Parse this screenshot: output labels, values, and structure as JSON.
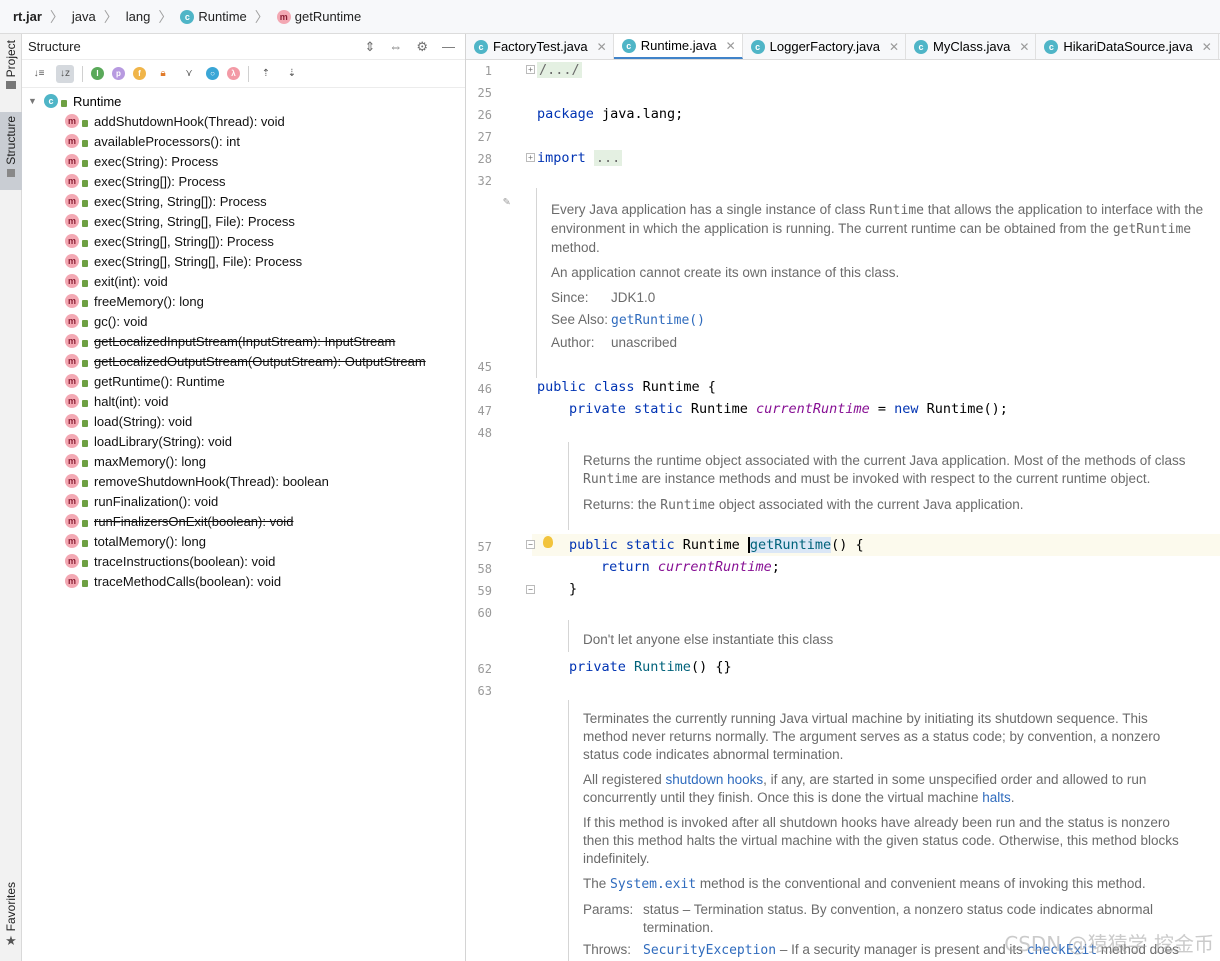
{
  "breadcrumb": [
    {
      "label": "rt.jar",
      "icon": "none"
    },
    {
      "label": "java",
      "icon": "none"
    },
    {
      "label": "lang",
      "icon": "none"
    },
    {
      "label": "Runtime",
      "icon": "class-icon"
    },
    {
      "label": "getRuntime",
      "icon": "method-icon"
    }
  ],
  "stripe": {
    "project": "Project",
    "structure": "Structure",
    "favorites": "Favorites"
  },
  "structure": {
    "title": "Structure",
    "toolbar": {
      "p": "p",
      "f": "f",
      "lambda": "λ",
      "i": "I"
    },
    "root": "Runtime",
    "items": [
      {
        "label": "addShutdownHook(Thread): void",
        "deprecated": false
      },
      {
        "label": "availableProcessors(): int",
        "deprecated": false
      },
      {
        "label": "exec(String): Process",
        "deprecated": false
      },
      {
        "label": "exec(String[]): Process",
        "deprecated": false
      },
      {
        "label": "exec(String, String[]): Process",
        "deprecated": false
      },
      {
        "label": "exec(String, String[], File): Process",
        "deprecated": false
      },
      {
        "label": "exec(String[], String[]): Process",
        "deprecated": false
      },
      {
        "label": "exec(String[], String[], File): Process",
        "deprecated": false
      },
      {
        "label": "exit(int): void",
        "deprecated": false
      },
      {
        "label": "freeMemory(): long",
        "deprecated": false
      },
      {
        "label": "gc(): void",
        "deprecated": false
      },
      {
        "label": "getLocalizedInputStream(InputStream): InputStream",
        "deprecated": true
      },
      {
        "label": "getLocalizedOutputStream(OutputStream): OutputStream",
        "deprecated": true
      },
      {
        "label": "getRuntime(): Runtime",
        "deprecated": false
      },
      {
        "label": "halt(int): void",
        "deprecated": false
      },
      {
        "label": "load(String): void",
        "deprecated": false
      },
      {
        "label": "loadLibrary(String): void",
        "deprecated": false
      },
      {
        "label": "maxMemory(): long",
        "deprecated": false
      },
      {
        "label": "removeShutdownHook(Thread): boolean",
        "deprecated": false
      },
      {
        "label": "runFinalization(): void",
        "deprecated": false
      },
      {
        "label": "runFinalizersOnExit(boolean): void",
        "deprecated": true
      },
      {
        "label": "totalMemory(): long",
        "deprecated": false
      },
      {
        "label": "traceInstructions(boolean): void",
        "deprecated": false
      },
      {
        "label": "traceMethodCalls(boolean): void",
        "deprecated": false
      }
    ]
  },
  "tabs": [
    {
      "label": "FactoryTest.java",
      "active": false
    },
    {
      "label": "Runtime.java",
      "active": true
    },
    {
      "label": "LoggerFactory.java",
      "active": false
    },
    {
      "label": "MyClass.java",
      "active": false
    },
    {
      "label": "HikariDataSource.java",
      "active": false
    }
  ],
  "code": {
    "line_numbers": [
      "1",
      "25",
      "26",
      "27",
      "28",
      "32",
      "45",
      "46",
      "47",
      "48",
      "57",
      "58",
      "59",
      "60",
      "62",
      "63"
    ],
    "fold1": "/.../",
    "kw_package": "package",
    "pkg": " java.lang;",
    "kw_import": "import",
    "import_fold": "...",
    "doc1": {
      "p1a": "Every Java application has a single instance of class ",
      "p1m": "Runtime",
      "p1b": " that allows the application to interface with the environment in which the application is running. The current runtime can be obtained from the ",
      "p1m2": "getRuntime",
      "p1c": " method.",
      "p2": "An application cannot create its own instance of this class.",
      "since_k": "Since:",
      "since_v": "JDK1.0",
      "see_k": "See Also:",
      "see_v": "getRuntime()",
      "author_k": "Author:",
      "author_v": "unascribed"
    },
    "l46_kw": "public class",
    "l46_rest": " Runtime {",
    "l47_kw": "private static",
    "l47_type": " Runtime ",
    "l47_field": "currentRuntime",
    "l47_eq": " = ",
    "l47_new": "new",
    "l47_rest": " Runtime();",
    "doc2": {
      "p1a": "Returns the runtime object associated with the current Java application. Most of the methods of class ",
      "p1m": "Runtime",
      "p1b": " are instance methods and must be invoked with respect to the current runtime object.",
      "p2a": "Returns: the ",
      "p2m": "Runtime",
      "p2b": " object associated with the current Java application."
    },
    "l57_kw": "public static",
    "l57_type": " Runtime ",
    "l57_fn": "getRuntime",
    "l57_rest": "() {",
    "l58_kw": "return",
    "l58_field": "currentRuntime",
    "l58_semi": ";",
    "l59": "}",
    "doc3": "Don't let anyone else instantiate this class",
    "l62_kw": "private",
    "l62_fn": " Runtime",
    "l62_rest": "() {}",
    "doc4": {
      "p1": "Terminates the currently running Java virtual machine by initiating its shutdown sequence. This method never returns normally. The argument serves as a status code; by convention, a nonzero status code indicates abnormal termination.",
      "p2a": "All registered ",
      "p2link": "shutdown hooks",
      "p2b": ", if any, are started in some unspecified order and allowed to run concurrently until they finish. Once this is done the virtual machine ",
      "p2link2": "halts",
      "p2c": ".",
      "p3": "If this method is invoked after all shutdown hooks have already been run and the status is nonzero then this method halts the virtual machine with the given status code. Otherwise, this method blocks indefinitely.",
      "p4a": "The ",
      "p4m": "System.exit",
      "p4b": " method is the conventional and convenient means of invoking this method.",
      "params_k": "Params:",
      "params_v": "status – Termination status. By convention, a nonzero status code indicates abnormal termination.",
      "throws_k": "Throws:",
      "throws_m": "SecurityException",
      "throws_v": " – If a security manager is present and its ",
      "throws_m2": "checkExit",
      "throws_v2": " method does"
    }
  },
  "watermark": "CSDN @猿猿学   挖金币",
  "colors": {
    "keyword": "#0033b3",
    "field": "#871094",
    "function": "#00627a",
    "link": "#2f6bbd",
    "doc_text": "#6b6b6b"
  }
}
